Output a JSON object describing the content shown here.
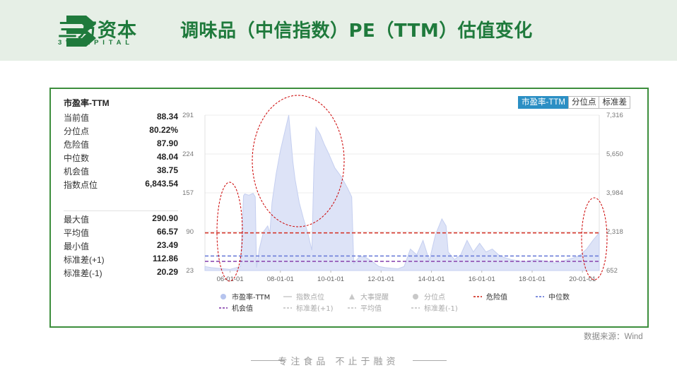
{
  "brand": {
    "name": "三万资本",
    "sub": "3WCAPITAL"
  },
  "page_title": "调味品（中信指数）PE（TTM）估值变化",
  "stats": {
    "title": "市盈率-TTM",
    "top": [
      {
        "label": "当前值",
        "value": "88.34"
      },
      {
        "label": "分位点",
        "value": "80.22%"
      },
      {
        "label": "危险值",
        "value": "87.90"
      },
      {
        "label": "中位数",
        "value": "48.04"
      },
      {
        "label": "机会值",
        "value": "38.75"
      },
      {
        "label": "指数点位",
        "value": "6,843.54"
      }
    ],
    "bottom": [
      {
        "label": "最大值",
        "value": "290.90"
      },
      {
        "label": "平均值",
        "value": "66.57"
      },
      {
        "label": "最小值",
        "value": "23.49"
      },
      {
        "label": "标准差(+1)",
        "value": "112.86"
      },
      {
        "label": "标准差(-1)",
        "value": "20.29"
      }
    ]
  },
  "tabs": [
    "市盈率-TTM",
    "分位点",
    "标准差"
  ],
  "source": "数据来源：Wind",
  "slogan": "专注食品  不止于融资",
  "colors": {
    "brand_green": "#1f7a3c",
    "area_fill": "#dde3f7",
    "area_line": "#c5cff0",
    "danger": "#d43a2f",
    "median": "#6d7fd9",
    "opportunity": "#8e4fb3",
    "tab_active": "#2b8fc4",
    "highlight_ellipse": "#cc0000"
  },
  "chart_data": {
    "type": "area",
    "title": "市盈率-TTM",
    "x_ticks": [
      "06-01-01",
      "08-01-01",
      "10-01-01",
      "12-01-01",
      "14-01-01",
      "16-01-01",
      "18-01-01",
      "20-01-01"
    ],
    "y_left_ticks": [
      "291",
      "224",
      "157",
      "90",
      "23"
    ],
    "y_right_ticks": [
      "7,316",
      "5,650",
      "3,984",
      "2,318",
      "652"
    ],
    "y_range": [
      23,
      291
    ],
    "series": [
      {
        "name": "市盈率-TTM",
        "points": [
          [
            "2005-01-01",
            30
          ],
          [
            "2005-04-01",
            28
          ],
          [
            "2005-07-01",
            27
          ],
          [
            "2005-10-01",
            26
          ],
          [
            "2006-01-01",
            25
          ],
          [
            "2006-03-01",
            27
          ],
          [
            "2006-06-01",
            30
          ],
          [
            "2006-07-15",
            152
          ],
          [
            "2006-08-01",
            155
          ],
          [
            "2006-10-01",
            153
          ],
          [
            "2006-12-01",
            156
          ],
          [
            "2007-01-01",
            150
          ],
          [
            "2007-01-20",
            28
          ],
          [
            "2007-03-01",
            60
          ],
          [
            "2007-05-01",
            90
          ],
          [
            "2007-07-01",
            100
          ],
          [
            "2007-08-01",
            88
          ],
          [
            "2007-09-01",
            140
          ],
          [
            "2007-11-01",
            190
          ],
          [
            "2008-01-01",
            230
          ],
          [
            "2008-03-01",
            260
          ],
          [
            "2008-05-01",
            291
          ],
          [
            "2008-06-01",
            250
          ],
          [
            "2008-07-01",
            210
          ],
          [
            "2008-08-01",
            180
          ],
          [
            "2008-10-01",
            140
          ],
          [
            "2008-12-01",
            112
          ],
          [
            "2009-02-01",
            88
          ],
          [
            "2009-04-01",
            58
          ],
          [
            "2009-05-01",
            200
          ],
          [
            "2009-06-01",
            270
          ],
          [
            "2009-08-01",
            258
          ],
          [
            "2009-10-01",
            240
          ],
          [
            "2009-12-01",
            225
          ],
          [
            "2010-03-01",
            200
          ],
          [
            "2010-06-01",
            185
          ],
          [
            "2010-09-01",
            165
          ],
          [
            "2010-11-01",
            150
          ],
          [
            "2010-12-01",
            35
          ],
          [
            "2011-03-01",
            48
          ],
          [
            "2011-06-01",
            45
          ],
          [
            "2011-09-01",
            38
          ],
          [
            "2011-12-01",
            30
          ],
          [
            "2012-03-01",
            28
          ],
          [
            "2012-06-01",
            27
          ],
          [
            "2012-09-01",
            26
          ],
          [
            "2012-12-01",
            30
          ],
          [
            "2013-03-01",
            60
          ],
          [
            "2013-06-01",
            50
          ],
          [
            "2013-09-01",
            75
          ],
          [
            "2013-12-01",
            40
          ],
          [
            "2014-03-01",
            85
          ],
          [
            "2014-06-01",
            112
          ],
          [
            "2014-08-01",
            100
          ],
          [
            "2014-09-01",
            55
          ],
          [
            "2014-12-01",
            42
          ],
          [
            "2015-03-01",
            50
          ],
          [
            "2015-06-01",
            75
          ],
          [
            "2015-09-01",
            55
          ],
          [
            "2015-12-01",
            70
          ],
          [
            "2016-03-01",
            55
          ],
          [
            "2016-06-01",
            60
          ],
          [
            "2016-09-01",
            50
          ],
          [
            "2016-12-01",
            45
          ],
          [
            "2017-03-01",
            42
          ],
          [
            "2017-06-01",
            40
          ],
          [
            "2017-09-01",
            38
          ],
          [
            "2017-12-01",
            40
          ],
          [
            "2018-03-01",
            42
          ],
          [
            "2018-06-01",
            40
          ],
          [
            "2018-09-01",
            38
          ],
          [
            "2018-12-01",
            36
          ],
          [
            "2019-03-01",
            38
          ],
          [
            "2019-06-01",
            42
          ],
          [
            "2019-09-01",
            45
          ],
          [
            "2019-12-01",
            50
          ],
          [
            "2020-03-01",
            60
          ],
          [
            "2020-06-01",
            75
          ],
          [
            "2020-09-01",
            88
          ]
        ]
      }
    ],
    "reference_lines": [
      {
        "name": "危险值",
        "value": 87.9
      },
      {
        "name": "中位数",
        "value": 48.04
      },
      {
        "name": "机会值",
        "value": 38.75
      }
    ],
    "legend": [
      {
        "name": "市盈率-TTM",
        "marker": "dot",
        "muted": false
      },
      {
        "name": "指数点位",
        "marker": "line",
        "muted": true
      },
      {
        "name": "大事提醒",
        "marker": "triangle",
        "muted": true
      },
      {
        "name": "分位点",
        "marker": "dot",
        "muted": true
      },
      {
        "name": "危险值",
        "marker": "dash",
        "muted": false
      },
      {
        "name": "中位数",
        "marker": "dash",
        "muted": false
      },
      {
        "name": "机会值",
        "marker": "dash",
        "muted": false
      },
      {
        "name": "标准差(+1)",
        "marker": "dash",
        "muted": true
      },
      {
        "name": "平均值",
        "marker": "dash",
        "muted": true
      },
      {
        "name": "标准差(-1)",
        "marker": "dash",
        "muted": true
      }
    ],
    "legend_position": "bottom",
    "grid": true
  }
}
